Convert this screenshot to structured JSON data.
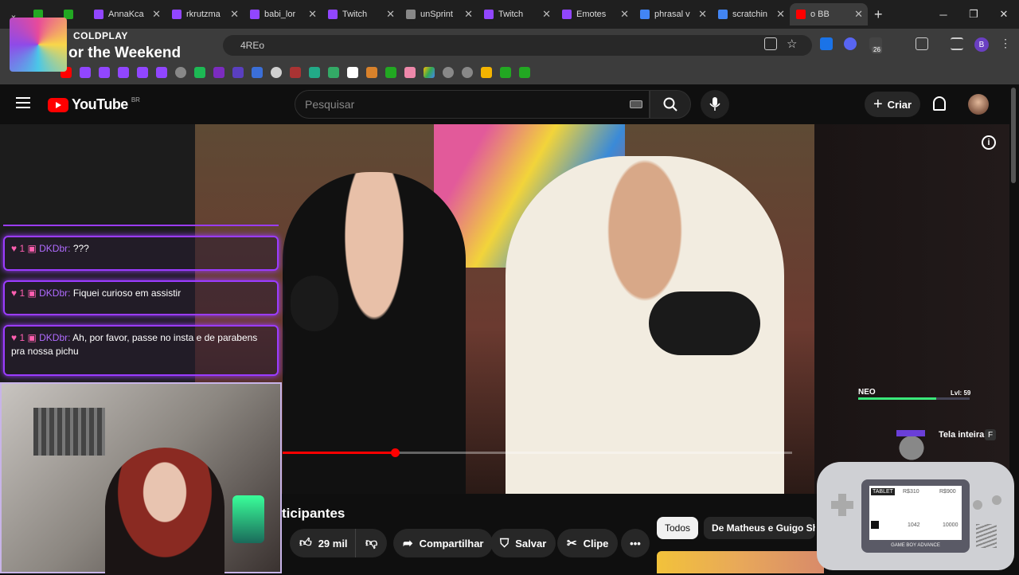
{
  "browser": {
    "tabs": [
      {
        "label": "",
        "color": "#22a822"
      },
      {
        "label": "",
        "color": "#22a822"
      },
      {
        "label": "AnnaKca",
        "color": "#9146ff"
      },
      {
        "label": "rkrutzma",
        "color": "#9146ff"
      },
      {
        "label": "babi_lor",
        "color": "#9146ff"
      },
      {
        "label": "Twitch",
        "color": "#9146ff"
      },
      {
        "label": "unSprint",
        "color": "#888888"
      },
      {
        "label": "Twitch",
        "color": "#9146ff"
      },
      {
        "label": "Emotes",
        "color": "#9146ff"
      },
      {
        "label": "phrasal v",
        "color": "#4285f4"
      },
      {
        "label": "scratchin",
        "color": "#4285f4"
      },
      {
        "label": "o BB",
        "color": "#ff0000"
      }
    ],
    "address_fragment": "4REo",
    "extension_badge": "26",
    "profile_letter": "B"
  },
  "spotify": {
    "artist": "COLDPLAY",
    "track": "or the Weekend"
  },
  "youtube": {
    "logo_text": "YouTube",
    "country": "BR",
    "search_placeholder": "Pesquisar",
    "create_label": "Criar",
    "video_title_fragment": "ticipantes",
    "like_count": "29 mil",
    "share_label": "Compartilhar",
    "save_label": "Salvar",
    "clip_label": "Clipe",
    "chips": [
      "Todos",
      "De Matheus e Guigo Sho"
    ]
  },
  "chat": {
    "messages": [
      {
        "user": "DKDbr:",
        "text": "???"
      },
      {
        "user": "DKDbr:",
        "text": "Fiquei curioso em assistir"
      },
      {
        "user": "DKDbr:",
        "text": "Ah, por favor, passe no insta e de parabens pra nossa pichu"
      }
    ]
  },
  "overlay": {
    "player_name": "NEO",
    "level": "Lvl: 59",
    "fullscreen_label": "Tela inteira",
    "fullscreen_key": "F",
    "gba_brand": "GAME BOY ADVANCE",
    "gba_screen": {
      "mode": "TABLET",
      "price_a": "R$310",
      "price_b": "R$900",
      "value_a": "1042",
      "value_b": "10000"
    }
  },
  "colors": {
    "accent": "#9146ff",
    "yt_red": "#ff0000"
  }
}
